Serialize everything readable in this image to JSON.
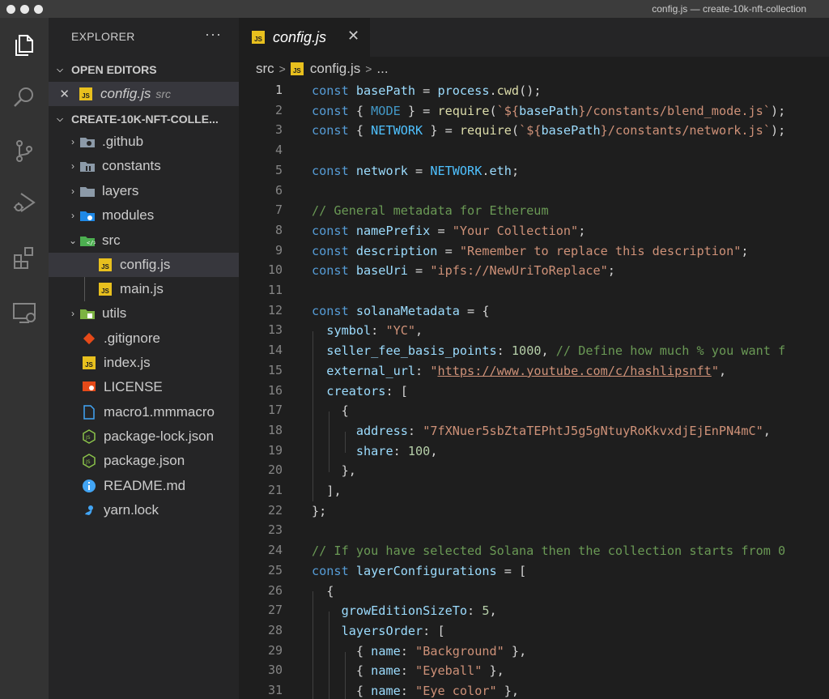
{
  "window": {
    "title": "config.js — create-10k-nft-collection"
  },
  "sidebar": {
    "title": "EXPLORER",
    "more": "···",
    "open_editors": {
      "label": "OPEN EDITORS",
      "items": [
        {
          "name": "config.js",
          "desc": "src"
        }
      ]
    },
    "project": {
      "label": "CREATE-10K-NFT-COLLE...",
      "items": [
        {
          "name": ".github",
          "type": "folder"
        },
        {
          "name": "constants",
          "type": "folder"
        },
        {
          "name": "layers",
          "type": "folder"
        },
        {
          "name": "modules",
          "type": "folder"
        },
        {
          "name": "src",
          "type": "folder-open"
        },
        {
          "name": "config.js",
          "type": "js"
        },
        {
          "name": "main.js",
          "type": "js"
        },
        {
          "name": "utils",
          "type": "folder"
        },
        {
          "name": ".gitignore",
          "type": "git"
        },
        {
          "name": "index.js",
          "type": "js"
        },
        {
          "name": "LICENSE",
          "type": "license"
        },
        {
          "name": "macro1.mmmacro",
          "type": "file"
        },
        {
          "name": "package-lock.json",
          "type": "node"
        },
        {
          "name": "package.json",
          "type": "node"
        },
        {
          "name": "README.md",
          "type": "info"
        },
        {
          "name": "yarn.lock",
          "type": "yarn"
        }
      ]
    }
  },
  "tabs": [
    {
      "label": "config.js",
      "close": "✕"
    }
  ],
  "breadcrumb": {
    "folder": "src",
    "file": "config.js",
    "rest": "..."
  },
  "editor": {
    "line_numbers": [
      "1",
      "2",
      "3",
      "4",
      "5",
      "6",
      "7",
      "8",
      "9",
      "10",
      "11",
      "12",
      "13",
      "14",
      "15",
      "16",
      "17",
      "18",
      "19",
      "20",
      "21",
      "22",
      "23",
      "24",
      "25",
      "26",
      "27",
      "28",
      "29",
      "30",
      "31"
    ],
    "code": {
      "l1": {
        "a": "const",
        "b": "basePath",
        "c": " = ",
        "d": "process",
        "e": ".",
        "f": "cwd",
        "g": "();"
      },
      "l2": {
        "a": "const",
        "b": " { ",
        "c": "MODE",
        "d": " } = ",
        "e": "require",
        "f": "(",
        "g": "`${",
        "h": "basePath",
        "i": "}/constants/blend_mode.js`",
        "j": ");"
      },
      "l3": {
        "a": "const",
        "b": " { ",
        "c": "NETWORK",
        "d": " } = ",
        "e": "require",
        "f": "(",
        "g": "`${",
        "h": "basePath",
        "i": "}/constants/network.js`",
        "j": ");"
      },
      "l5": {
        "a": "const",
        "b": "network",
        "c": " = ",
        "d": "NETWORK",
        "e": ".",
        "f": "eth",
        "g": ";"
      },
      "l7": {
        "a": "// General metadata for Ethereum"
      },
      "l8": {
        "a": "const",
        "b": "namePrefix",
        "c": " = ",
        "d": "\"Your Collection\"",
        "e": ";"
      },
      "l9": {
        "a": "const",
        "b": "description",
        "c": " = ",
        "d": "\"Remember to replace this description\"",
        "e": ";"
      },
      "l10": {
        "a": "const",
        "b": "baseUri",
        "c": " = ",
        "d": "\"ipfs://NewUriToReplace\"",
        "e": ";"
      },
      "l12": {
        "a": "const",
        "b": "solanaMetadata",
        "c": " = {"
      },
      "l13": {
        "a": "symbol",
        "b": ": ",
        "c": "\"YC\"",
        "d": ","
      },
      "l14": {
        "a": "seller_fee_basis_points",
        "b": ": ",
        "c": "1000",
        "d": ", ",
        "e": "// Define how much % you want f"
      },
      "l15": {
        "a": "external_url",
        "b": ": ",
        "c": "\"",
        "d": "https://www.youtube.com/c/hashlipsnft",
        "e": "\"",
        "f": ","
      },
      "l16": {
        "a": "creators",
        "b": ": ["
      },
      "l17": {
        "a": "{"
      },
      "l18": {
        "a": "address",
        "b": ": ",
        "c": "\"7fXNuer5sbZtaTEPhtJ5g5gNtuyRoKkvxdjEjEnPN4mC\"",
        "d": ","
      },
      "l19": {
        "a": "share",
        "b": ": ",
        "c": "100",
        "d": ","
      },
      "l20": {
        "a": "},"
      },
      "l21": {
        "a": "],"
      },
      "l22": {
        "a": "};"
      },
      "l24": {
        "a": "// If you have selected Solana then the collection starts from 0"
      },
      "l25": {
        "a": "const",
        "b": "layerConfigurations",
        "c": " = ["
      },
      "l26": {
        "a": "{"
      },
      "l27": {
        "a": "growEditionSizeTo",
        "b": ": ",
        "c": "5",
        "d": ","
      },
      "l28": {
        "a": "layersOrder",
        "b": ": ["
      },
      "l29": {
        "a": "{ ",
        "b": "name",
        "c": ": ",
        "d": "\"Background\"",
        "e": " },"
      },
      "l30": {
        "a": "{ ",
        "b": "name",
        "c": ": ",
        "d": "\"Eyeball\"",
        "e": " },"
      },
      "l31": {
        "a": "{ ",
        "b": "name",
        "c": ": ",
        "d": "\"Eye color\"",
        "e": " },"
      }
    }
  },
  "colors": {
    "activity_bar": "#333333",
    "sidebar": "#252526",
    "editor": "#1e1e1e",
    "keyword": "#569cd6",
    "string": "#ce9178",
    "comment": "#6a9955",
    "js_badge": "#e8c01e"
  }
}
